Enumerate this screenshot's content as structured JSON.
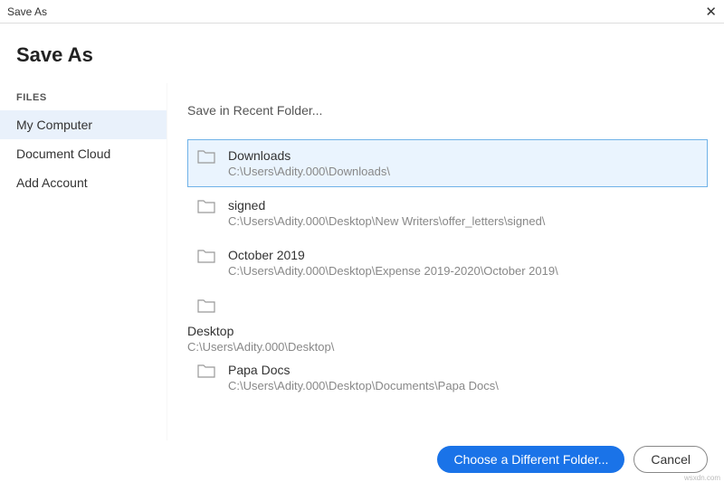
{
  "titlebar": {
    "title": "Save As"
  },
  "header": {
    "title": "Save As"
  },
  "sidebar": {
    "heading": "FILES",
    "items": [
      {
        "label": "My Computer",
        "selected": true
      },
      {
        "label": "Document Cloud",
        "selected": false
      },
      {
        "label": "Add Account",
        "selected": false
      }
    ]
  },
  "main": {
    "section_label": "Save in Recent Folder...",
    "folders": [
      {
        "name": "Downloads",
        "path": "C:\\Users\\Adity.000\\Downloads\\",
        "selected": true
      },
      {
        "name": "signed",
        "path": "C:\\Users\\Adity.000\\Desktop\\New Writers\\offer_letters\\signed\\",
        "selected": false
      },
      {
        "name": "October 2019",
        "path": "C:\\Users\\Adity.000\\Desktop\\Expense 2019-2020\\October 2019\\",
        "selected": false
      },
      {
        "name": "Desktop",
        "path": "C:\\Users\\Adity.000\\Desktop\\",
        "selected": false
      },
      {
        "name": "Papa Docs",
        "path": "C:\\Users\\Adity.000\\Desktop\\Documents\\Papa Docs\\",
        "selected": false
      }
    ]
  },
  "footer": {
    "choose_label": "Choose a Different Folder...",
    "cancel_label": "Cancel"
  },
  "watermark": "wsxdn.com"
}
